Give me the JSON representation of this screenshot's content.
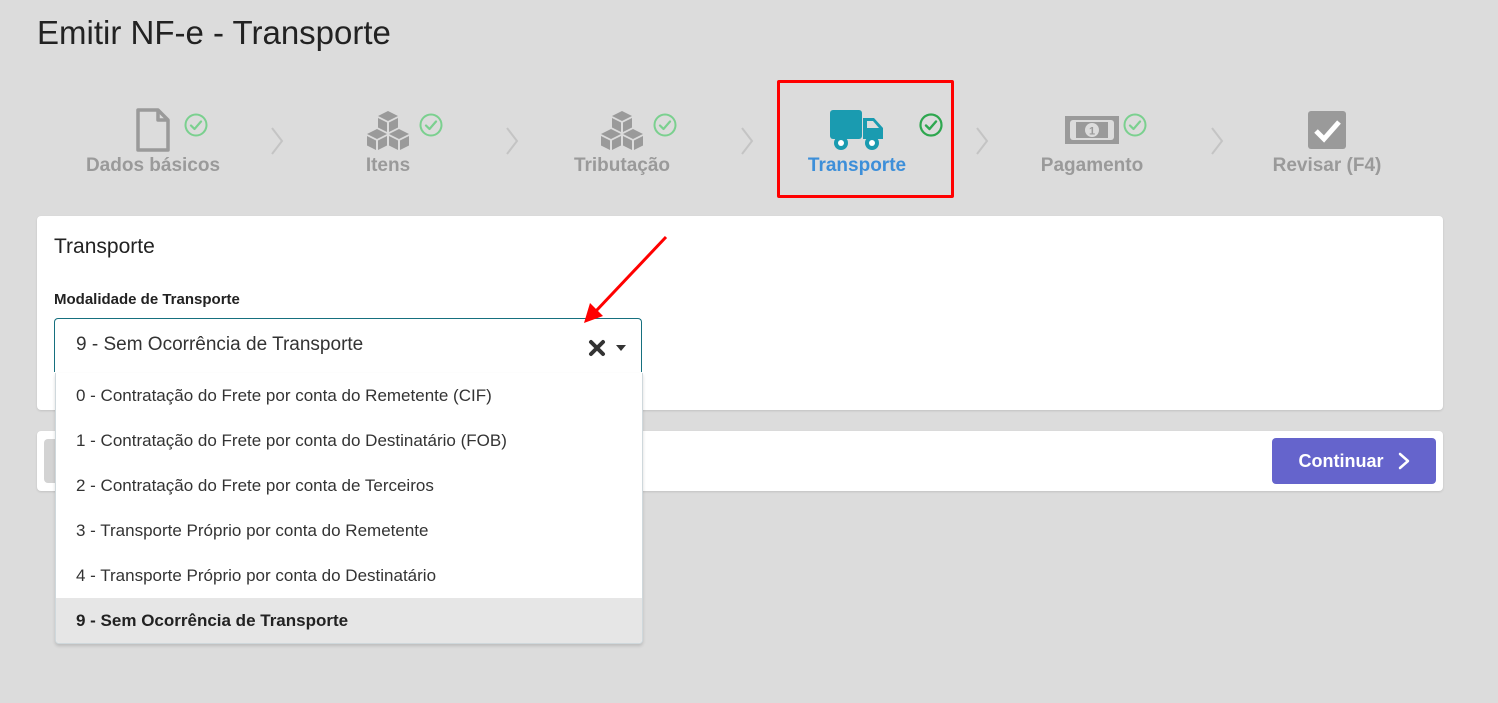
{
  "page": {
    "title": "Emitir NF-e - Transporte"
  },
  "steps": [
    {
      "label": "Dados básicos",
      "icon": "file-icon",
      "completed": true,
      "active": false
    },
    {
      "label": "Itens",
      "icon": "boxes-icon",
      "completed": true,
      "active": false
    },
    {
      "label": "Tributação",
      "icon": "boxes-icon",
      "completed": true,
      "active": false
    },
    {
      "label": "Transporte",
      "icon": "truck-icon",
      "completed": true,
      "active": true
    },
    {
      "label": "Pagamento",
      "icon": "money-bill-icon",
      "completed": true,
      "active": false
    },
    {
      "label": "Revisar (F4)",
      "icon": "checkbox-icon",
      "completed": false,
      "active": false
    }
  ],
  "colors": {
    "active_step": "#3d8fd9",
    "inactive_step": "#9a9a9a",
    "check_green": "#2ea74f",
    "check_light": "#7bd08f",
    "truck": "#1a9bb0",
    "primary_button": "#6564cc",
    "annotation": "#ff0000"
  },
  "card": {
    "title": "Transporte",
    "field_label": "Modalidade de Transporte",
    "selected_value": "9 - Sem Ocorrência de Transporte",
    "options": [
      "0 - Contratação do Frete por conta do Remetente (CIF)",
      "1 - Contratação do Frete por conta do Destinatário (FOB)",
      "2 - Contratação do Frete por conta de Terceiros",
      "3 - Transporte Próprio por conta do Remetente",
      "4 - Transporte Próprio por conta do Destinatário",
      "9 - Sem Ocorrência de Transporte"
    ],
    "selected_index": 5
  },
  "footer": {
    "continue_label": "Continuar"
  }
}
